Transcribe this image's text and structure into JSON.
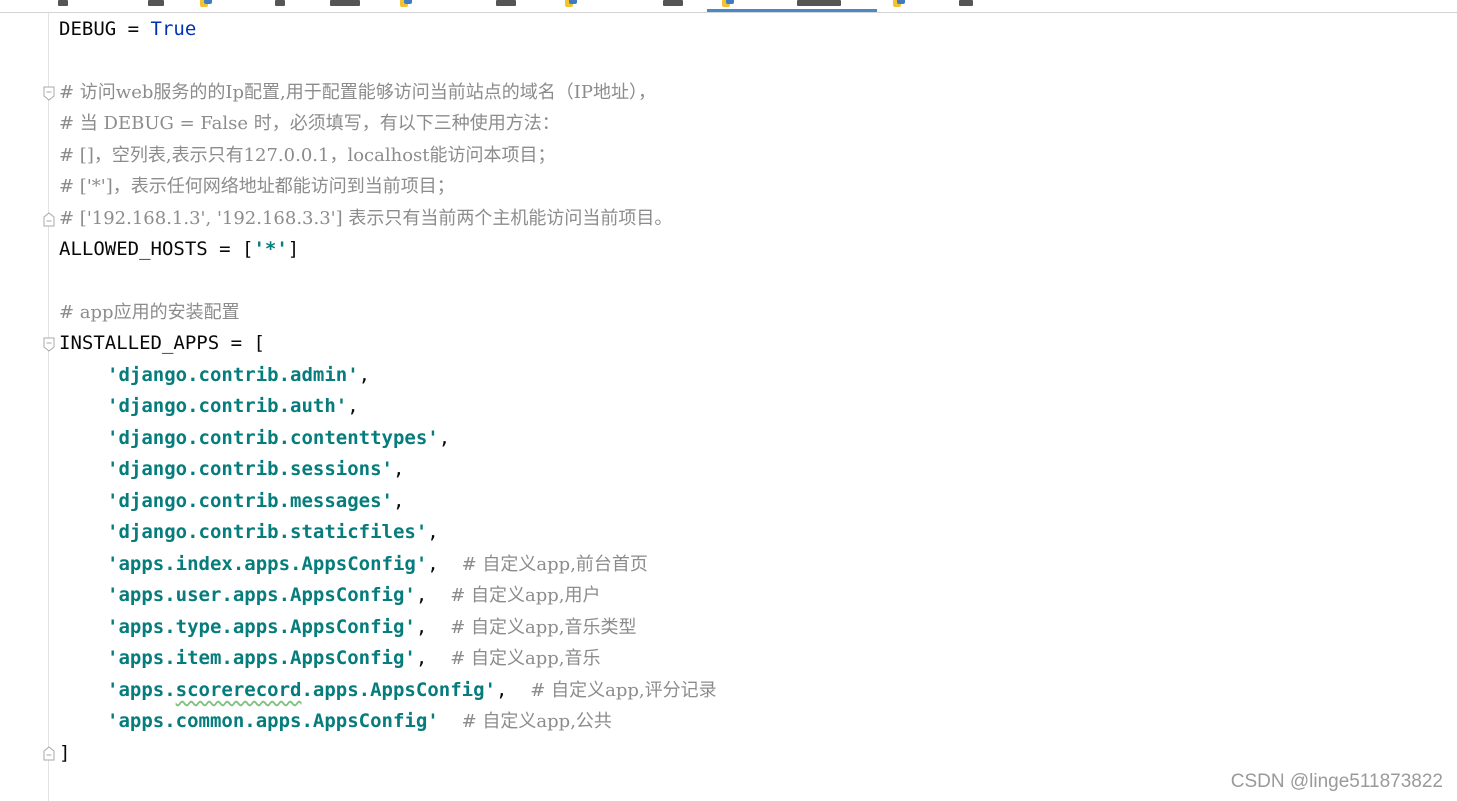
{
  "code": {
    "debug_name": "DEBUG",
    "debug_eq": " = ",
    "debug_value": "True",
    "comment_hosts_1": "# 访问web服务的的Ip配置,用于配置能够访问当前站点的域名（IP地址），",
    "comment_hosts_2": "# 当 DEBUG = False 时，必须填写，有以下三种使用方法：",
    "comment_hosts_3": "# []，空列表,表示只有127.0.0.1，localhost能访问本项目；",
    "comment_hosts_4": "# ['*']，表示任何网络地址都能访问到当前项目；",
    "comment_hosts_5": "# ['192.168.1.3', '192.168.3.3'] 表示只有当前两个主机能访问当前项目。",
    "allowed_hosts_name": "ALLOWED_HOSTS = [",
    "allowed_hosts_value": "'*'",
    "allowed_hosts_close": "]",
    "comment_apps": "# app应用的安装配置",
    "installed_apps_open": "INSTALLED_APPS = [",
    "apps": [
      {
        "value": "'django.contrib.admin'",
        "sep": ",",
        "comment": ""
      },
      {
        "value": "'django.contrib.auth'",
        "sep": ",",
        "comment": ""
      },
      {
        "value": "'django.contrib.contenttypes'",
        "sep": ",",
        "comment": ""
      },
      {
        "value": "'django.contrib.sessions'",
        "sep": ",",
        "comment": ""
      },
      {
        "value": "'django.contrib.messages'",
        "sep": ",",
        "comment": ""
      },
      {
        "value": "'django.contrib.staticfiles'",
        "sep": ",",
        "comment": ""
      },
      {
        "value": "'apps.index.apps.AppsConfig'",
        "sep": ",  ",
        "comment": "# 自定义app,前台首页"
      },
      {
        "value": "'apps.user.apps.AppsConfig'",
        "sep": ",  ",
        "comment": "# 自定义app,用户"
      },
      {
        "value": "'apps.type.apps.AppsConfig'",
        "sep": ",  ",
        "comment": "# 自定义app,音乐类型"
      },
      {
        "value": "'apps.item.apps.AppsConfig'",
        "sep": ",  ",
        "comment": "# 自定义app,音乐"
      },
      {
        "value_a": "'apps.",
        "value_b": "scorerecord",
        "value_c": ".apps.AppsConfig'",
        "sep": ",  ",
        "comment": "# 自定义app,评分记录"
      },
      {
        "value": "'apps.common.apps.AppsConfig'",
        "sep": "  ",
        "comment": "# 自定义app,公共"
      }
    ],
    "installed_apps_close": "]"
  },
  "watermark": "CSDN @linge511873822",
  "colors": {
    "keyword": "#0033b3",
    "string": "#067d7c",
    "comment": "#8c8c8c",
    "active_tab": "#4a88c7"
  },
  "icons": {
    "tab": "python-file-icon",
    "fold": "fold-marker-icon"
  }
}
